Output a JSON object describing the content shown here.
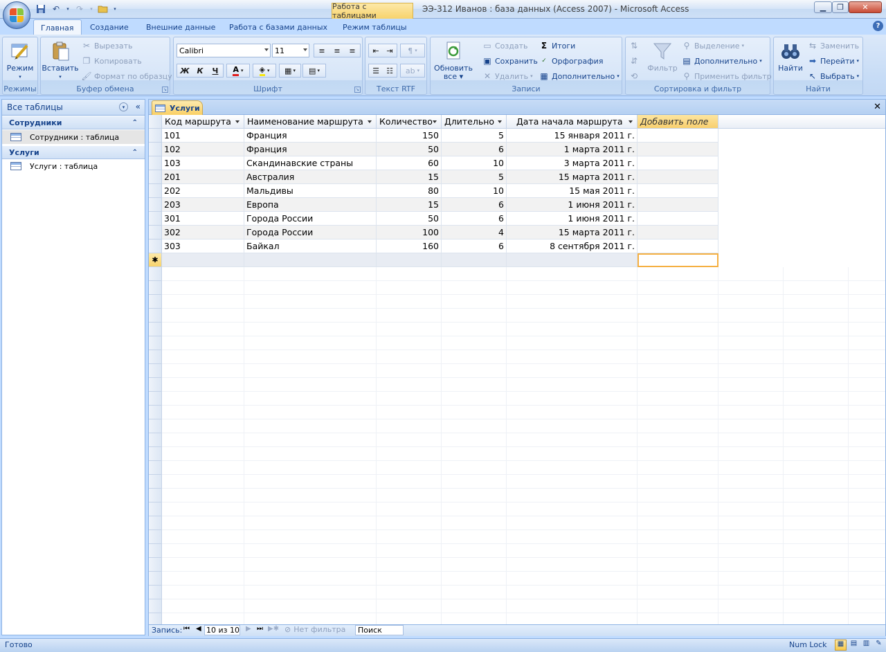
{
  "app": {
    "context_tab": "Работа с таблицами",
    "window_title": "ЭЭ-312 Иванов : база данных (Access 2007) - Microsoft Access"
  },
  "ribbon_tabs": [
    "Главная",
    "Создание",
    "Внешние данные",
    "Работа с базами данных",
    "Режим таблицы"
  ],
  "ribbon": {
    "groups": {
      "views": "Режимы",
      "clipboard": "Буфер обмена",
      "font": "Шрифт",
      "rtf": "Текст RTF",
      "records": "Записи",
      "sort": "Сортировка и фильтр",
      "find": "Найти"
    },
    "view_btn": "Режим",
    "paste_btn": "Вставить",
    "cut": "Вырезать",
    "copy": "Копировать",
    "format_painter": "Формат по образцу",
    "font_name": "Calibri",
    "font_size": "11",
    "bold": "Ж",
    "italic": "К",
    "underline": "Ч",
    "refresh_line1": "Обновить",
    "refresh_line2": "все",
    "new": "Создать",
    "save": "Сохранить",
    "delete": "Удалить",
    "totals": "Итоги",
    "spelling": "Орфография",
    "more_records": "Дополнительно",
    "filter": "Фильтр",
    "selection": "Выделение",
    "advanced": "Дополнительно",
    "apply_filter": "Применить фильтр",
    "find_btn": "Найти",
    "replace": "Заменить",
    "goto": "Перейти",
    "select": "Выбрать"
  },
  "nav": {
    "header": "Все таблицы",
    "groups": [
      {
        "name": "Сотрудники",
        "items": [
          "Сотрудники : таблица"
        ]
      },
      {
        "name": "Услуги",
        "items": [
          "Услуги : таблица"
        ]
      }
    ]
  },
  "doc_tab": "Услуги",
  "table": {
    "columns": [
      "Код маршрута",
      "Наименование маршрута",
      "Количество",
      "Длительно",
      "Дата начала маршрута"
    ],
    "add_field": "Добавить поле",
    "rows": [
      [
        "101",
        "Франция",
        "150",
        "5",
        "15 января 2011 г."
      ],
      [
        "102",
        "Франция",
        "50",
        "6",
        "1 марта 2011 г."
      ],
      [
        "103",
        "Скандинавские страны",
        "60",
        "10",
        "3 марта 2011 г."
      ],
      [
        "201",
        "Австралия",
        "15",
        "5",
        "15 марта 2011 г."
      ],
      [
        "202",
        "Мальдивы",
        "80",
        "10",
        "15 мая 2011 г."
      ],
      [
        "203",
        "Европа",
        "15",
        "6",
        "1 июня 2011 г."
      ],
      [
        "301",
        "Города России",
        "50",
        "6",
        "1 июня 2011 г."
      ],
      [
        "302",
        "Города России",
        "100",
        "4",
        "15 марта 2011 г."
      ],
      [
        "303",
        "Байкал",
        "160",
        "6",
        "8 сентября 2011 г."
      ]
    ],
    "new_row_marker": "✱"
  },
  "record_nav": {
    "label": "Запись:",
    "position": "10 из 10",
    "filter": "Нет фильтра",
    "search": "Поиск"
  },
  "status": {
    "left": "Готово",
    "numlock": "Num Lock"
  },
  "colors": {
    "ribbon_bg": "#bfdbff",
    "accent_tab": "#f9cf64",
    "text": "#15428b"
  }
}
